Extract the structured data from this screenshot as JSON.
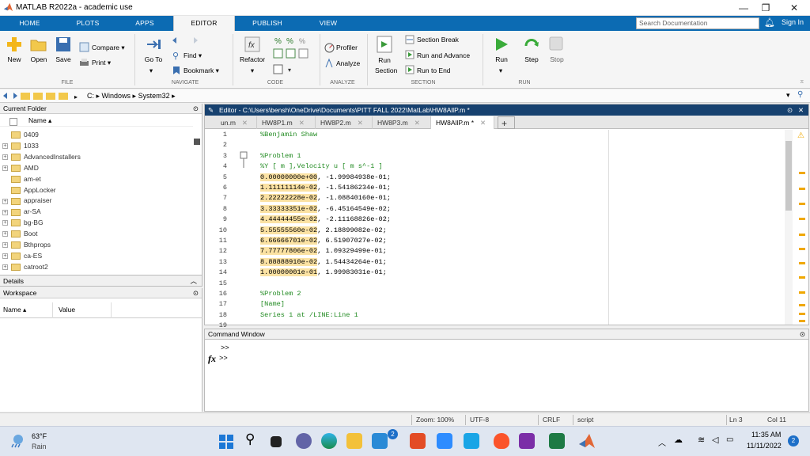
{
  "titlebar": {
    "title": "MATLAB R2022a - academic use"
  },
  "ribbon_tabs": [
    "HOME",
    "PLOTS",
    "APPS",
    "EDITOR",
    "PUBLISH",
    "VIEW"
  ],
  "search": {
    "placeholder": "Search Documentation"
  },
  "signin": "Sign In",
  "ribbon": {
    "file": {
      "new": "New",
      "open": "Open",
      "save": "Save",
      "compare": "Compare",
      "print": "Print",
      "label": "FILE"
    },
    "navigate": {
      "goto": "Go To",
      "find": "Find",
      "bookmark": "Bookmark",
      "label": "NAVIGATE"
    },
    "code": {
      "refactor": "Refactor",
      "label": "CODE"
    },
    "analyze": {
      "profiler": "Profiler",
      "analyze": "Analyze",
      "label": "ANALYZE"
    },
    "section": {
      "run_section": "Run Section",
      "section_break": "Section Break",
      "run_advance": "Run and Advance",
      "run_end": "Run to End",
      "label": "SECTION"
    },
    "run": {
      "run": "Run",
      "step": "Step",
      "stop": "Stop",
      "label": "RUN"
    }
  },
  "address": {
    "drive": "C:",
    "p1": "Windows",
    "p2": "System32"
  },
  "current_folder": {
    "title": "Current Folder",
    "col_name": "Name",
    "items": [
      {
        "name": "0409",
        "expand": false
      },
      {
        "name": "1033",
        "expand": true
      },
      {
        "name": "AdvancedInstallers",
        "expand": true
      },
      {
        "name": "AMD",
        "expand": true
      },
      {
        "name": "am-et",
        "expand": false
      },
      {
        "name": "AppLocker",
        "expand": false
      },
      {
        "name": "appraiser",
        "expand": true
      },
      {
        "name": "ar-SA",
        "expand": true
      },
      {
        "name": "bg-BG",
        "expand": true
      },
      {
        "name": "Boot",
        "expand": true
      },
      {
        "name": "Bthprops",
        "expand": true
      },
      {
        "name": "ca-ES",
        "expand": true
      },
      {
        "name": "catroot2",
        "expand": true
      }
    ]
  },
  "details": "Details",
  "workspace": {
    "title": "Workspace",
    "col_name": "Name",
    "col_value": "Value"
  },
  "editor": {
    "title": "Editor - C:\\Users\\bensh\\OneDrive\\Documents\\PITT FALL 2022\\MatLab\\HW8AllP.m *",
    "tabs": [
      "un.m",
      "HW8P1.m",
      "HW8P2.m",
      "HW8P3.m",
      "HW8AllP.m *"
    ],
    "line_numbers": [
      "1",
      "2",
      "3",
      "4",
      "5",
      "6",
      "7",
      "8",
      "9",
      "10",
      "11",
      "12",
      "13",
      "14",
      "15",
      "16",
      "17",
      "18",
      "19"
    ],
    "lines": [
      {
        "t": "%Benjamin Shaw",
        "c": "cmt"
      },
      {
        "t": "",
        "c": ""
      },
      {
        "t": "%Problem 1",
        "c": "cmt"
      },
      {
        "t": "%Y [ m ],Velocity u [ m s^-1 ]",
        "c": "cmt"
      },
      {
        "h": "0.00000000e+00",
        "t": ", -1.99984938e-01;",
        "c": ""
      },
      {
        "h": "1.11111114e-02",
        "t": ", -1.54186234e-01;",
        "c": ""
      },
      {
        "h": "2.22222228e-02",
        "t": ", -1.08840160e-01;",
        "c": ""
      },
      {
        "h": "3.33333351e-02",
        "t": ", -6.45164549e-02;",
        "c": ""
      },
      {
        "h": "4.44444455e-02",
        "t": ", -2.11168826e-02;",
        "c": ""
      },
      {
        "h": "5.55555560e-02",
        "t": ", 2.18899082e-02;",
        "c": ""
      },
      {
        "h": "6.66666701e-02",
        "t": ", 6.51907027e-02;",
        "c": ""
      },
      {
        "h": "7.77777806e-02",
        "t": ", 1.09329499e-01;",
        "c": ""
      },
      {
        "h": "8.88888910e-02",
        "t": ", 1.54434264e-01;",
        "c": ""
      },
      {
        "h": "1.00000001e-01",
        "t": ", 1.99983031e-01;",
        "c": ""
      },
      {
        "t": "",
        "c": ""
      },
      {
        "t": "%Problem 2",
        "c": "cmt"
      },
      {
        "t": "[Name]",
        "c": "cmt"
      },
      {
        "t": "Series 1 at /LINE:Line 1",
        "c": "cmt"
      },
      {
        "t": "",
        "c": ""
      }
    ]
  },
  "command_window": {
    "title": "Command Window",
    "prompt1": ">>",
    "fx": "fx",
    "prompt2": ">>"
  },
  "status": {
    "zoom": "Zoom: 100%",
    "enc": "UTF-8",
    "eol": "CRLF",
    "type": "script",
    "ln": "Ln 3",
    "col": "Col 11"
  },
  "taskbar": {
    "temp": "63°F",
    "weather": "Rain",
    "time": "11:35 AM",
    "date": "11/11/2022",
    "badge": "2"
  },
  "colors": {
    "ribbon_blue": "#0c6bb3",
    "editor_header": "#17416f",
    "highlight": "#fbe2a3",
    "comment": "#228b22"
  }
}
